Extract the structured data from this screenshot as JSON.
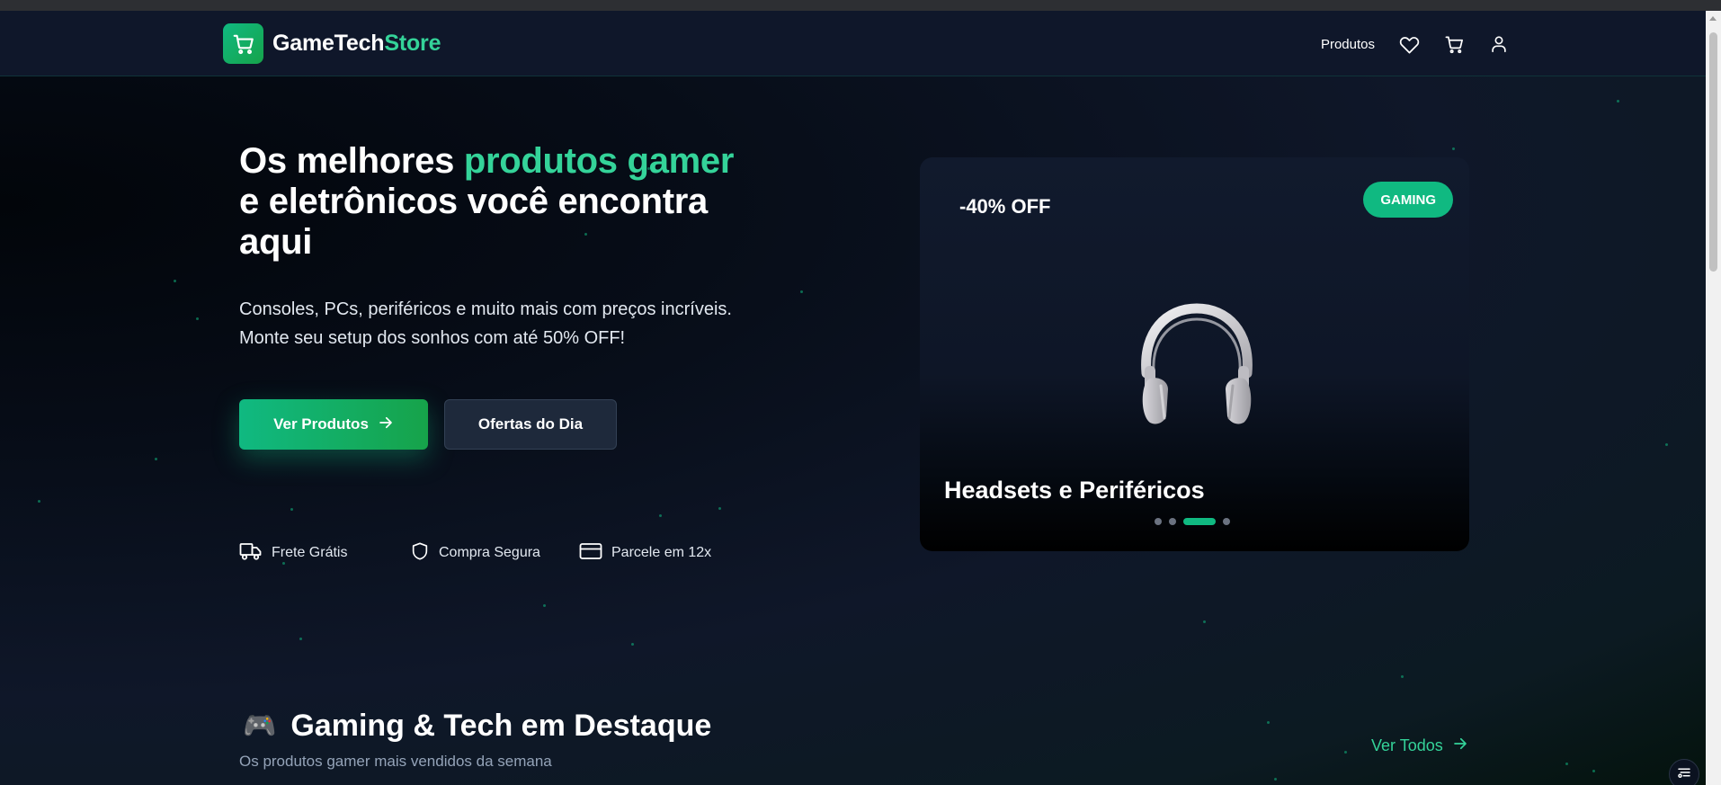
{
  "brand": {
    "name_part1": "GameTech",
    "name_part2": "Store"
  },
  "nav": {
    "products_label": "Produtos"
  },
  "hero": {
    "title_part1": "Os melhores ",
    "title_highlight": "produtos gamer",
    "title_part2": " e eletrônicos você encontra aqui",
    "desc_line1": "Consoles, PCs, periféricos e muito mais com preços incríveis.",
    "desc_line2": "Monte seu setup dos sonhos com até 50% OFF!",
    "primary_button": "Ver Produtos",
    "secondary_button": "Ofertas do Dia",
    "features": [
      "Frete Grátis",
      "Compra Segura",
      "Parcele em 12x"
    ]
  },
  "carousel": {
    "discount": "-40% OFF",
    "tag": "GAMING",
    "title": "Headsets e Periféricos",
    "slide_count": 4,
    "active_slide": 3
  },
  "section": {
    "emoji": "🎮",
    "title": "Gaming & Tech em Destaque",
    "subtitle": "Os produtos gamer mais vendidos da semana",
    "see_all": "Ver Todos"
  },
  "colors": {
    "accent": "#10b981",
    "accent_text": "#34d399",
    "background": "#0f172a"
  },
  "icons": {
    "logo": "cart-icon",
    "favorites": "heart-icon",
    "cart": "cart-icon",
    "account": "user-icon",
    "primary_button": "arrow-right-icon",
    "features": [
      "truck-icon",
      "shield-icon",
      "credit-card-icon"
    ],
    "see_all": "arrow-right-icon",
    "floating": "filter-icon"
  }
}
